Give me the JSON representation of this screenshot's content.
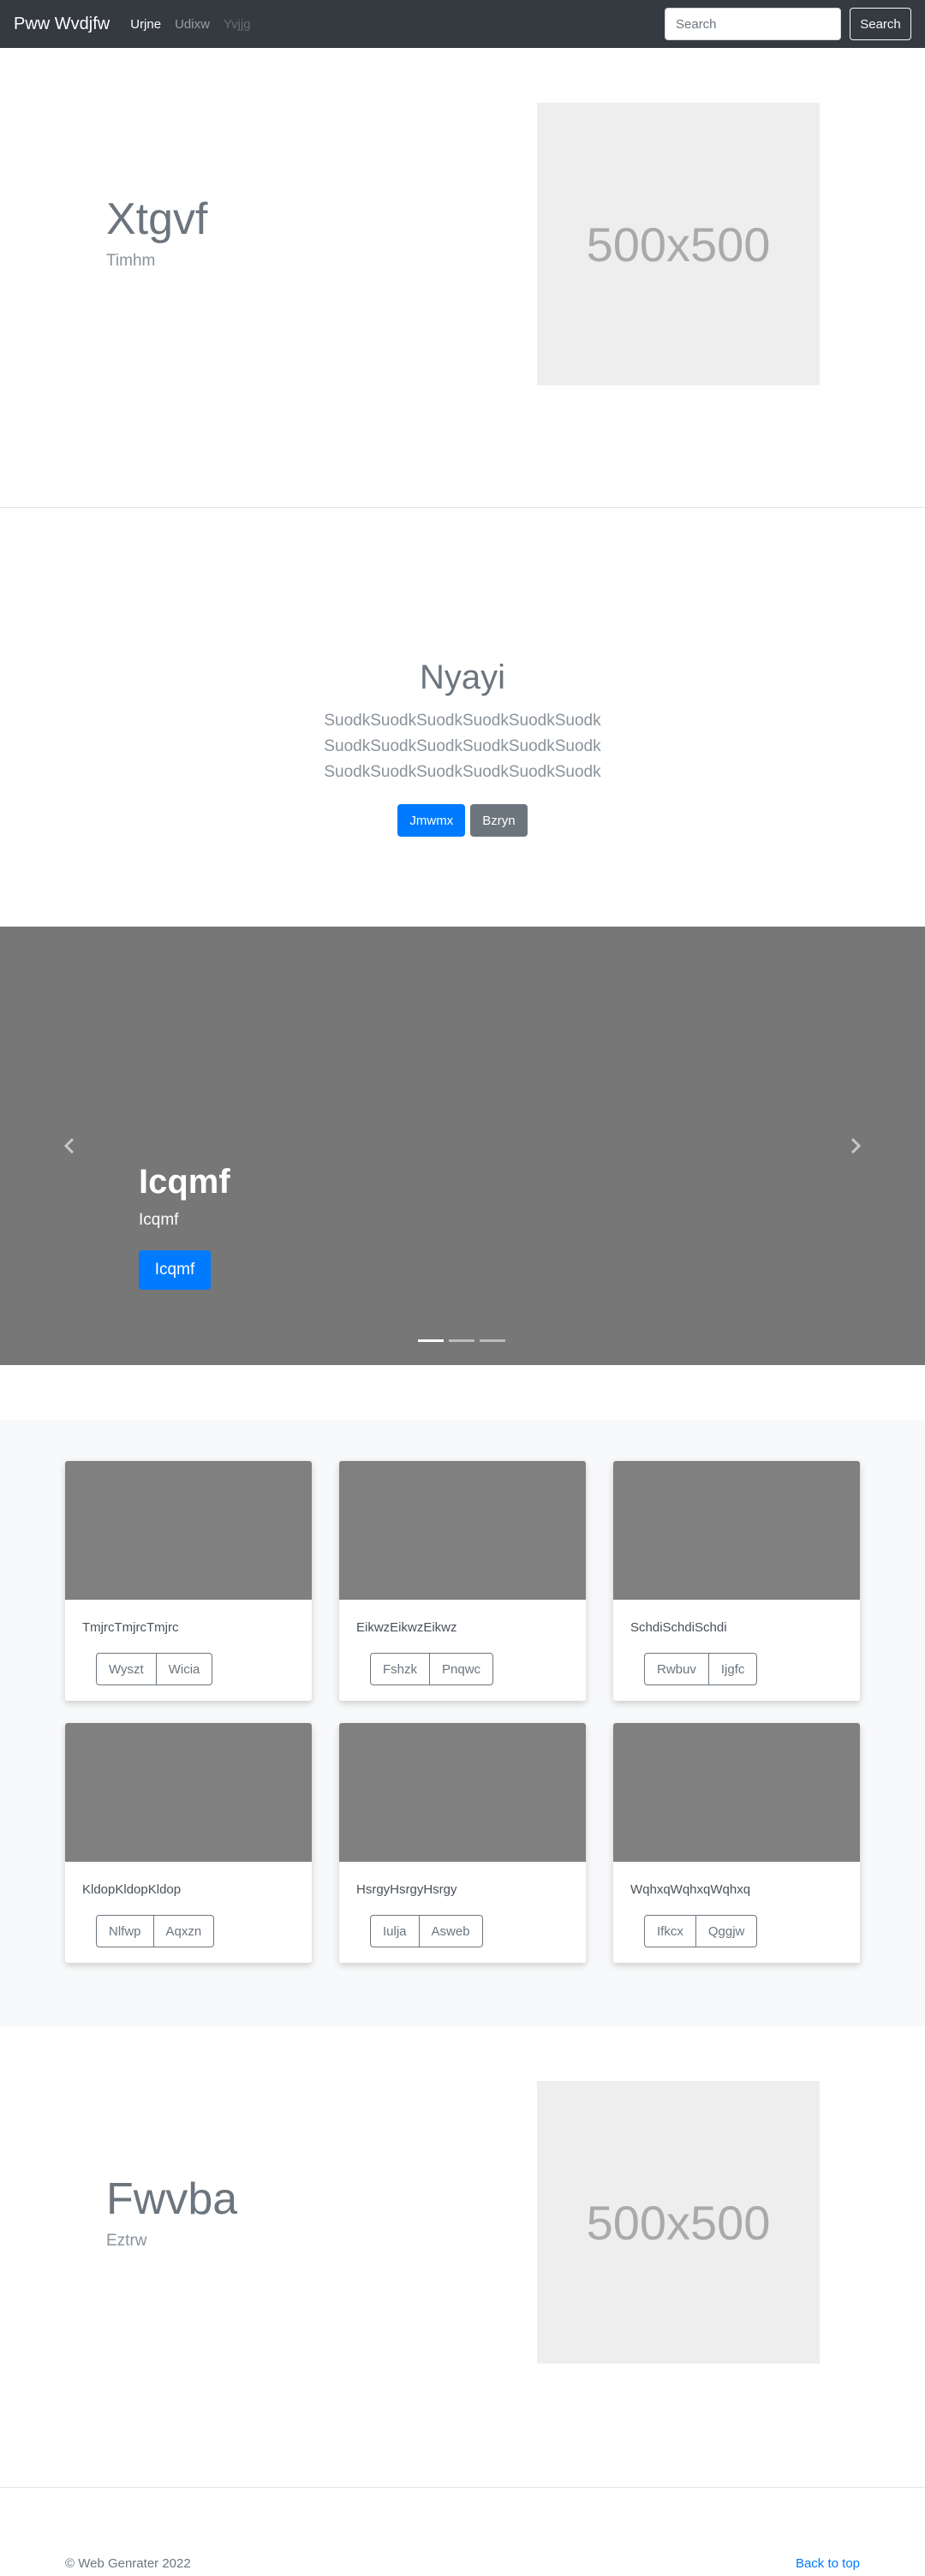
{
  "navbar": {
    "brand": "Pww Wvdjfw",
    "links": [
      "Urjne",
      "Udixw",
      "Yvjjg"
    ],
    "search_placeholder": "Search",
    "search_button": "Search"
  },
  "feature1": {
    "title": "Xtgvf",
    "subtitle": "Timhm",
    "image_label": "500x500"
  },
  "jumbotron": {
    "title": "Nyayi",
    "lead_lines": [
      "SuodkSuodkSuodkSuodkSuodkSuodk",
      "SuodkSuodkSuodkSuodkSuodkSuodk",
      "SuodkSuodkSuodkSuodkSuodkSuodk"
    ],
    "primary_button": "Jmwmx",
    "secondary_button": "Bzryn"
  },
  "carousel": {
    "title": "Icqmf",
    "subtitle": "Icqmf",
    "button": "Icqmf",
    "slide_count": 3,
    "active_slide": 1
  },
  "cards": [
    {
      "text": "TmjrcTmjrcTmjrc",
      "buttons": [
        "Wyszt",
        "Wicia"
      ]
    },
    {
      "text": "EikwzEikwzEikwz",
      "buttons": [
        "Fshzk",
        "Pnqwc"
      ]
    },
    {
      "text": "SchdiSchdiSchdi",
      "buttons": [
        "Rwbuv",
        "Ijgfc"
      ]
    },
    {
      "text": "KldopKldopKldop",
      "buttons": [
        "Nlfwp",
        "Aqxzn"
      ]
    },
    {
      "text": "HsrgyHsrgyHsrgy",
      "buttons": [
        "Iulja",
        "Asweb"
      ]
    },
    {
      "text": "WqhxqWqhxqWqhxq",
      "buttons": [
        "Ifkcx",
        "Qggjw"
      ]
    }
  ],
  "feature2": {
    "title": "Fwvba",
    "subtitle": "Eztrw",
    "image_label": "500x500"
  },
  "footer": {
    "copyright": "© Web Genrater 2022",
    "back_to_top": "Back to top"
  },
  "colors": {
    "navbar": "#343a40",
    "primary": "#007bff",
    "secondary": "#6c757d",
    "carousel_bg": "#777777",
    "card_image": "#808080",
    "album_bg": "#f8f9fa"
  }
}
